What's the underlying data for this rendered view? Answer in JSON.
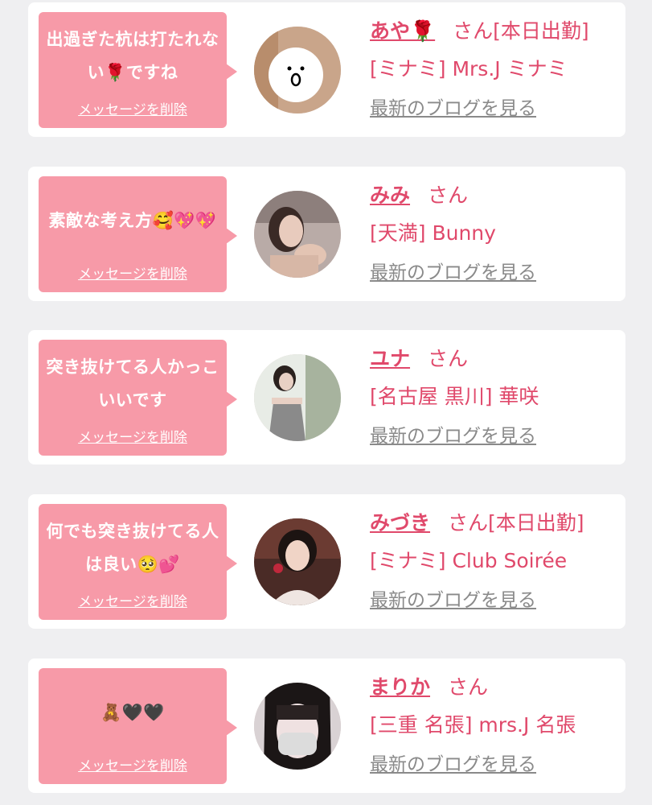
{
  "delete_label": "メッセージを削除",
  "blog_label": "最新のブログを見る",
  "colors": {
    "accent": "#e0496b",
    "bubble": "#f79aa8",
    "card": "#ffffff",
    "background": "#efeff1",
    "link": "#8a8a8a"
  },
  "cards": [
    {
      "message": "出過ぎた杭は打たれない🌹ですね",
      "name": "あや🌹",
      "honorific": "さん[本日出勤]",
      "shop": "[ミナミ] Mrs.J ミナミ",
      "avatar_icon": "avatar-face-drawing-icon"
    },
    {
      "message": "素敵な考え方🥰💖💖",
      "name": "みみ",
      "honorific": "さん",
      "shop": "[天満] Bunny",
      "avatar_icon": "avatar-photo-icon"
    },
    {
      "message": "突き抜けてる人かっこいいです",
      "name": "ユナ",
      "honorific": "さん",
      "shop": "[名古屋 黒川] 華咲",
      "avatar_icon": "avatar-photo-icon"
    },
    {
      "message": "何でも突き抜けてる人は良い🥺💕",
      "name": "みづき",
      "honorific": "さん[本日出勤]",
      "shop": "[ミナミ] Club Soirée",
      "avatar_icon": "avatar-photo-icon"
    },
    {
      "message": "🧸🖤🖤",
      "name": "まりか",
      "honorific": "さん",
      "shop": "[三重 名張] mrs.J 名張",
      "avatar_icon": "avatar-photo-icon"
    }
  ]
}
